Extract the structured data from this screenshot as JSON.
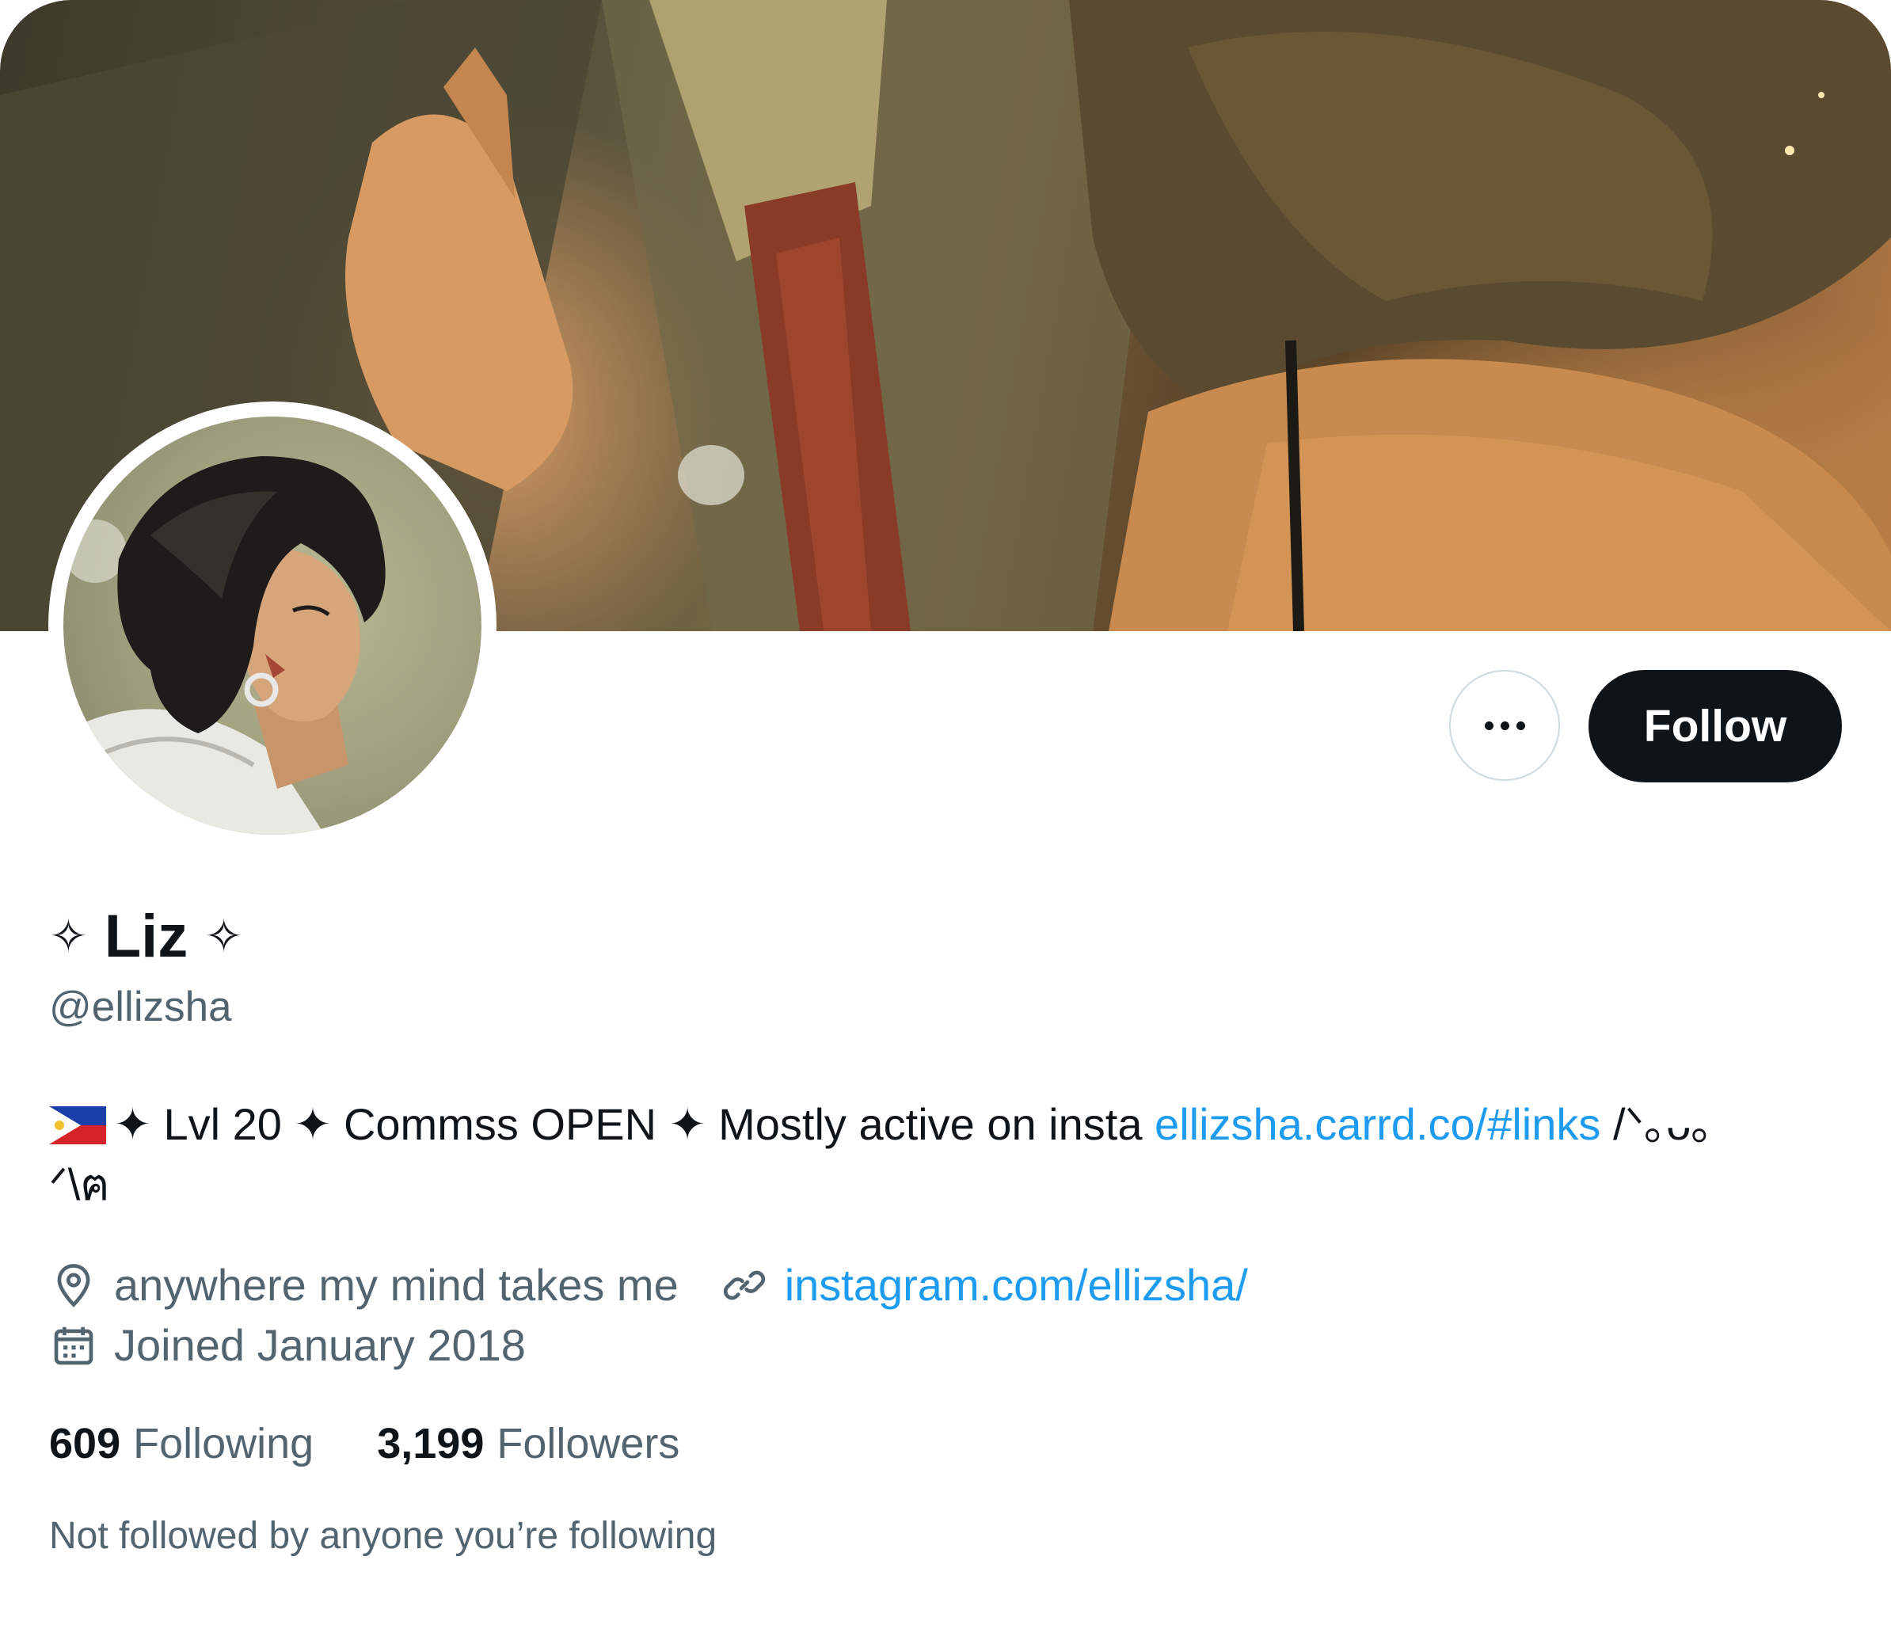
{
  "profile": {
    "display_name": "Liz",
    "name_decoration_left": "✧",
    "name_decoration_right": "✧",
    "handle": "@ellizsha",
    "bio": {
      "text": "✦ Lvl 20 ✦ Commss OPEN ✦ Mostly active on insta",
      "link": "ellizsha.carrd.co/#links",
      "suffix_line1": "/ᐠ｡ᴗ｡",
      "suffix_line2": "ᐟ\\ฅ",
      "flag_icon": "philippines-flag-icon"
    },
    "location": "anywhere my mind takes me",
    "website": "instagram.com/ellizsha/",
    "joined": "Joined January 2018"
  },
  "stats": {
    "following_count": "609",
    "following_label": "Following",
    "followers_count": "3,199",
    "followers_label": "Followers"
  },
  "actions": {
    "follow_label": "Follow",
    "more_icon": "more-icon"
  },
  "footer": {
    "not_followed_text": "Not followed by anyone you’re following"
  },
  "colors": {
    "accent": "#1d9bf0",
    "text_primary": "#0f1419",
    "text_secondary": "#536471",
    "follow_button_bg": "#0f1419",
    "border": "#cfd9de"
  }
}
